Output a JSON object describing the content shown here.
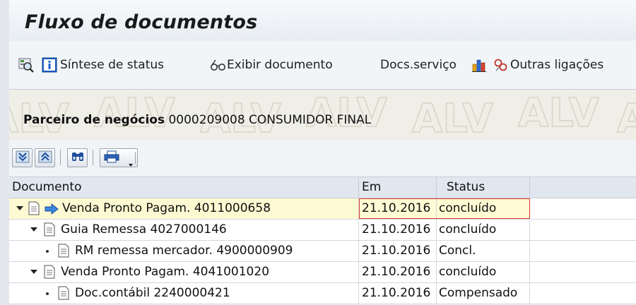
{
  "window": {
    "title": "Fluxo de documentos"
  },
  "toolbar": {
    "status_overview": "Síntese de status",
    "display_document": "Exibir documento",
    "service_docs": "Docs.serviço",
    "other_links": "Outras ligações"
  },
  "header_panel": {
    "partner_label": "Parceiro de negócios",
    "partner_value": "0000209008 CONSUMIDOR FINAL",
    "watermark_text": "ALV"
  },
  "table": {
    "columns": [
      "Documento",
      "Em",
      "Status"
    ],
    "rows": [
      {
        "document": "Venda Pronto Pagam. 4011000658",
        "date": "21.10.2016",
        "status": "concluído",
        "level": 0,
        "expander": "expanded",
        "current": true
      },
      {
        "document": "Guia Remessa 4027000146",
        "date": "21.10.2016",
        "status": "concluído",
        "level": 1,
        "expander": "expanded",
        "current": false
      },
      {
        "document": "RM remessa mercador. 4900000909",
        "date": "21.10.2016",
        "status": "Concl.",
        "level": 2,
        "expander": "leaf",
        "current": false
      },
      {
        "document": "Venda Pronto Pagam. 4041001020",
        "date": "21.10.2016",
        "status": "concluído",
        "level": 1,
        "expander": "expanded",
        "current": false
      },
      {
        "document": "Doc.contábil 2240000421",
        "date": "21.10.2016",
        "status": "Compensado",
        "level": 2,
        "expander": "leaf",
        "current": false
      }
    ]
  },
  "icons": {
    "toolbar": [
      "magnifier-tree-icon",
      "info-icon",
      "glasses-icon",
      "chart-icon",
      "link-icon"
    ],
    "grid_toolbar": [
      "expand-all-icon",
      "collapse-all-icon",
      "find-icon",
      "print-icon",
      "dropdown-icon"
    ]
  }
}
